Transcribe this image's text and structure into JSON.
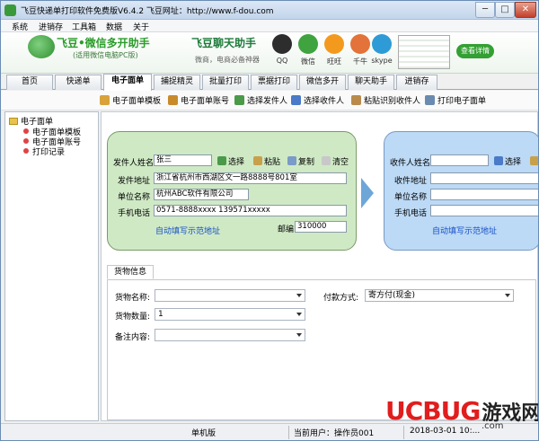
{
  "window": {
    "title": "飞豆快递单打印软件免费版V6.4.2  飞豆网址：http://www.f-dou.com",
    "btn_min": "─",
    "btn_max": "□",
    "btn_close": "✕"
  },
  "menu": [
    "系统",
    "进销存",
    "工具箱",
    "数据",
    "关于"
  ],
  "banner": {
    "headline": "飞豆•微信多开助手",
    "sub": "(适用微信电脑PC版)",
    "chat_title": "飞豆聊天助手",
    "chat_sub": "微商，电商必备神器",
    "apps": [
      "QQ",
      "微信",
      "旺旺",
      "千牛",
      "skype"
    ],
    "more": "查看详情"
  },
  "tabs": [
    "首页",
    "快递单",
    "电子面单",
    "捕捉精灵",
    "批量打印",
    "票据打印",
    "微信多开",
    "聊天助手",
    "进销存"
  ],
  "active_tab": "电子面单",
  "toolbar": [
    "电子面单模板",
    "电子面单账号",
    "选择发件人",
    "选择收件人",
    "粘贴识别收件人",
    "打印电子面单"
  ],
  "tree": {
    "root": "电子面单",
    "children": [
      "电子面单模板",
      "电子面单账号",
      "打印记录"
    ]
  },
  "sender": {
    "name_label": "发件人姓名",
    "name_value": "张三",
    "select": "选择",
    "paste": "粘贴",
    "copy": "复制",
    "clear": "清空",
    "addr_label": "发件地址",
    "addr_value": "浙江省杭州市西湖区文一路8888号801室",
    "unit_label": "单位名称",
    "unit_value": "杭州ABC软件有限公司",
    "phone_label": "手机电话",
    "phone_value": "0571-8888xxxx 139571xxxxx",
    "example_link": "自动填写示范地址",
    "zip_label": "邮编",
    "zip_value": "310000"
  },
  "receiver": {
    "name_label": "收件人姓名",
    "select": "选择",
    "addr_label": "收件地址",
    "unit_label": "单位名称",
    "phone_label": "手机电话",
    "example_link": "自动填写示范地址"
  },
  "goods": {
    "tab": "货物信息",
    "name_label": "货物名称:",
    "qty_label": "货物数量:",
    "qty_value": "1",
    "note_label": "备注内容:",
    "pay_label": "付款方式:",
    "pay_value": "寄方付(现金)"
  },
  "status": {
    "mode": "单机版",
    "user": "当前用户：操作员001",
    "datetime": "2018-03-01 10:..."
  },
  "watermark": {
    "uc": "UCBUG",
    "cn": "游戏网",
    "com": ".com"
  }
}
